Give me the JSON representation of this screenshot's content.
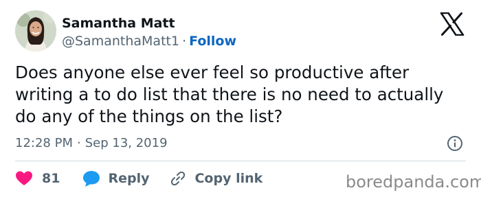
{
  "tweet": {
    "author_name": "Samantha Matt",
    "author_handle": "@SamanthaMatt1",
    "separator": "·",
    "follow_label": "Follow",
    "text": "Does anyone else ever feel so productive after writing a to do list that there is no need to actually do any of the things on the list?",
    "time": "12:28 PM",
    "date": "Sep 13, 2019",
    "likes_count": "81",
    "reply_label": "Reply",
    "copy_link_label": "Copy link"
  },
  "icons": {
    "platform_logo": "x-logo-icon",
    "info": "info-icon",
    "like": "heart-icon",
    "reply": "speech-bubble-icon",
    "copy_link": "link-icon"
  },
  "colors": {
    "like": "#f91880",
    "reply": "#1d9bf0",
    "follow": "#0a66c2",
    "secondary_text": "#536471"
  },
  "watermark": "boredpanda.com"
}
